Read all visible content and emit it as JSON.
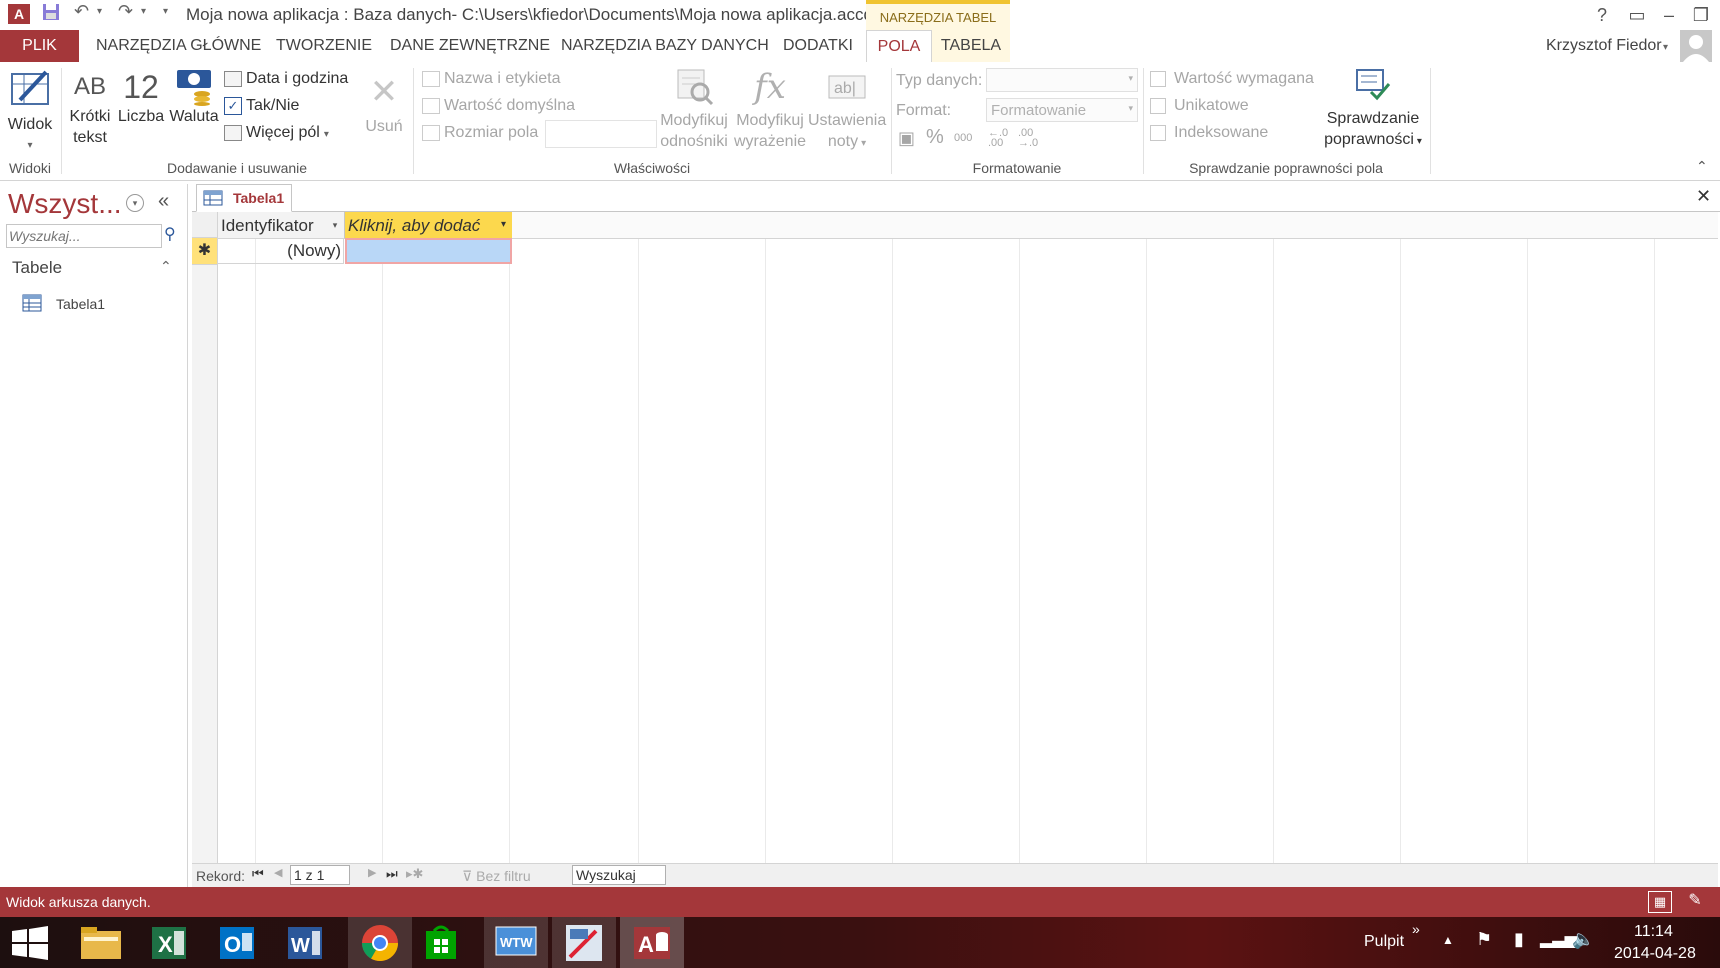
{
  "titlebar": {
    "title": "Moja nowa aplikacja : Baza danych- C:\\Users\\kfiedor\\Documents\\Moja nowa aplikacja.accdb...",
    "context_header": "NARZĘDZIA TABEL",
    "help": "?",
    "app_icon": "A",
    "save_icon": "save-icon",
    "undo_icon": "undo-icon",
    "redo_icon": "redo-icon"
  },
  "tabs": {
    "file": "PLIK",
    "home": "NARZĘDZIA GŁÓWNE",
    "create": "TWORZENIE",
    "external": "DANE ZEWNĘTRZNE",
    "dbtools": "NARZĘDZIA BAZY DANYCH",
    "addins": "DODATKI",
    "fields": "POLA",
    "table": "TABELA"
  },
  "user": {
    "name": "Krzysztof Fiedor"
  },
  "ribbon": {
    "views": {
      "view_label": "Widok",
      "group": "Widoki"
    },
    "add": {
      "short_text_icon": "AB",
      "short_text_1": "Krótki",
      "short_text_2": "tekst",
      "number_icon": "12",
      "number": "Liczba",
      "currency": "Waluta",
      "datetime": "Data i godzina",
      "yesno": "Tak/Nie",
      "more": "Więcej pól",
      "delete": "Usuń",
      "group": "Dodawanie i usuwanie"
    },
    "props": {
      "name_caption": "Nazwa i etykieta",
      "default_value": "Wartość domyślna",
      "field_size": "Rozmiar pola",
      "lookups_1": "Modyfikuj",
      "lookups_2": "odnośniki",
      "expression_1": "Modyfikuj",
      "expression_2": "wyrażenie",
      "memo_1": "Ustawienia",
      "memo_2": "noty",
      "group": "Właściwości"
    },
    "format": {
      "datatype_label": "Typ danych:",
      "format_label": "Format:",
      "format_value": "Formatowanie",
      "percent": "%",
      "thousands": "000",
      "group": "Formatowanie"
    },
    "validation": {
      "required": "Wartość wymagana",
      "unique": "Unikatowe",
      "indexed": "Indeksowane",
      "validation_1": "Sprawdzanie",
      "validation_2": "poprawności",
      "group": "Sprawdzanie poprawności pola"
    }
  },
  "navpane": {
    "title": "Wszyst...",
    "search_placeholder": "Wyszukaj...",
    "section": "Tabele",
    "items": [
      {
        "label": "Tabela1"
      }
    ]
  },
  "document": {
    "tab_label": "Tabela1",
    "columns": [
      {
        "label": "Identyfikator"
      },
      {
        "label": "Kliknij, aby dodać"
      }
    ],
    "new_row_marker": "✱",
    "new_row_value": "(Nowy)"
  },
  "recordnav": {
    "label": "Rekord:",
    "position": "1 z 1",
    "filter": "Bez filtru",
    "search": "Wyszukaj"
  },
  "status": {
    "text": "Widok arkusza danych."
  },
  "taskbar": {
    "desktop_label": "Pulpit",
    "time": "11:14",
    "date": "2014-04-28",
    "apps": [
      {
        "icon": "file-explorer-icon"
      },
      {
        "icon": "excel-icon"
      },
      {
        "icon": "outlook-icon"
      },
      {
        "icon": "word-icon"
      },
      {
        "icon": "chrome-icon"
      },
      {
        "icon": "store-icon"
      },
      {
        "icon": "wtw-icon"
      },
      {
        "icon": "paint-icon"
      },
      {
        "icon": "access-icon"
      }
    ]
  },
  "colors": {
    "accent": "#a4373a",
    "context": "#f0c330",
    "selected_cell": "#b9d7f7"
  }
}
